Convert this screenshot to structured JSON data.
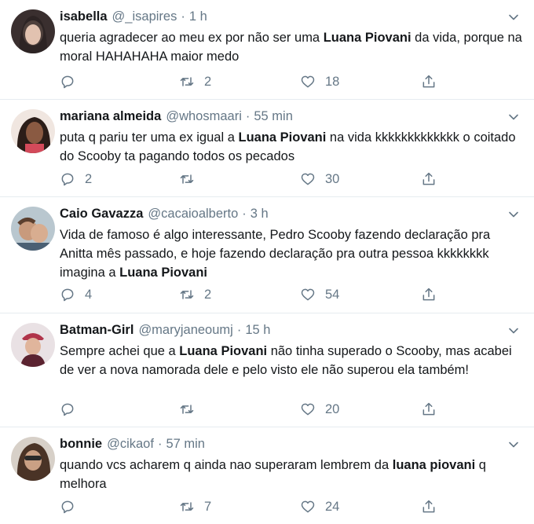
{
  "tweets": [
    {
      "name": "isabella",
      "handle": "@_isapires",
      "time": "1 h",
      "text_parts": [
        "queria agradecer ao meu ex por não ser uma ",
        "Luana Piovani",
        " da vida, porque na moral HAHAHAHA maior medo"
      ],
      "replies": "",
      "retweets": "2",
      "likes": "18"
    },
    {
      "name": "mariana almeida",
      "handle": "@whosmaari",
      "time": "55 min",
      "text_parts": [
        "puta q pariu ter uma ex igual a ",
        "Luana Piovani",
        " na vida kkkkkkkkkkkkk o coitado do Scooby ta pagando todos os pecados"
      ],
      "replies": "2",
      "retweets": "",
      "likes": "30"
    },
    {
      "name": "Caio Gavazza",
      "handle": "@cacaioalberto",
      "time": "3 h",
      "text_parts": [
        "Vida de famoso é algo interessante, Pedro Scooby fazendo declaração pra Anitta mês passado, e hoje fazendo declaração pra outra pessoa kkkkkkkk imagina a ",
        "Luana Piovani",
        ""
      ],
      "replies": "4",
      "retweets": "2",
      "likes": "54"
    },
    {
      "name": "Batman-Girl",
      "handle": "@maryjaneoumj",
      "time": "15 h",
      "text_parts": [
        "Sempre achei que a ",
        "Luana Piovani",
        " não tinha superado o Scooby, mas acabei de ver a nova namorada dele e pelo visto ele não superou ela também!"
      ],
      "replies": "",
      "retweets": "",
      "likes": "20"
    },
    {
      "name": "bonnie",
      "handle": "@cikaof",
      "time": "57 min",
      "text_parts": [
        "quando vcs acharem q ainda nao superaram lembrem da ",
        "luana piovani",
        " q melhora"
      ],
      "replies": "",
      "retweets": "7",
      "likes": "24"
    }
  ],
  "separator": "·",
  "colors": {
    "text": "#14171a",
    "secondary": "#657786",
    "divider": "#e6ecf0"
  },
  "icons": [
    "reply-icon",
    "retweet-icon",
    "like-icon",
    "share-icon",
    "chevron-down-icon"
  ]
}
